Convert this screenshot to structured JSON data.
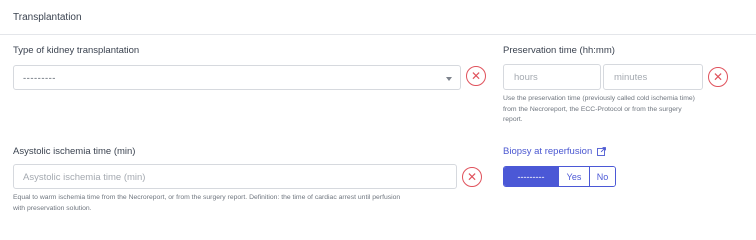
{
  "section": {
    "title": "Transplantation"
  },
  "kidney_type": {
    "label": "Type of kidney transplantation",
    "value": "---------",
    "icon": "chevron-down-icon"
  },
  "preservation": {
    "label": "Preservation time (hh:mm)",
    "hours_placeholder": "hours",
    "minutes_placeholder": "minutes",
    "help": [
      "Use the preservation time (previously called cold ischemia time)",
      "from the Necroreport, the ECC-Protocol or from the surgery",
      "report."
    ]
  },
  "asystolic": {
    "label": "Asystolic ischemia time (min)",
    "placeholder": "Asystolic ischemia time (min)",
    "help": [
      "Equal to warm ischemia time from the Necroreport, or from the surgery report. Definition: the time of cardiac arrest until perfusion",
      "with preservation solution."
    ]
  },
  "biopsy": {
    "label": "Biopsy at reperfusion",
    "icon": "external-link-icon",
    "options": [
      "---------",
      "Yes",
      "No"
    ],
    "selected": "---------"
  },
  "clear_icon": "close-icon",
  "colors": {
    "accent": "#4b58d6",
    "danger": "#e0525c",
    "border": "#d6d9de"
  }
}
